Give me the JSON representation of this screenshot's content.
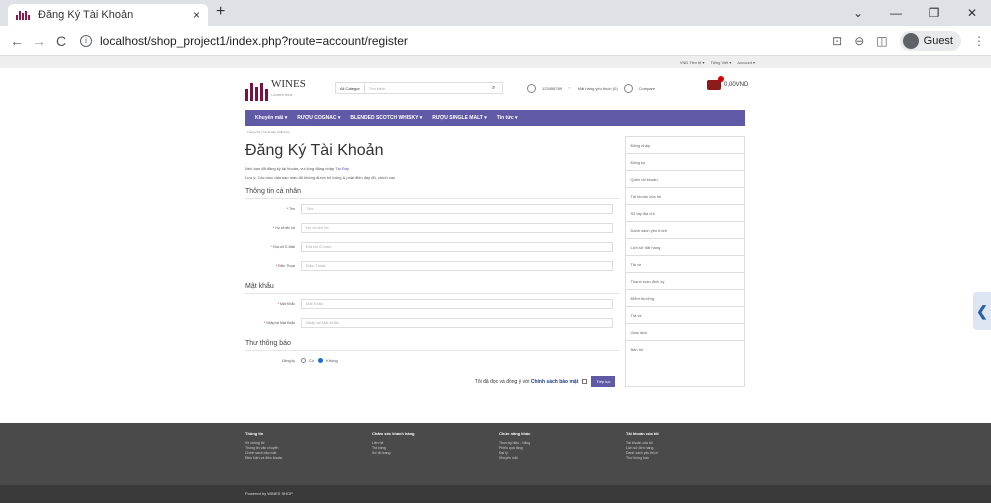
{
  "browser": {
    "tab_title": "Đăng Ký Tài Khoản",
    "tab_close": "×",
    "new_tab": "+",
    "url": "localhost/shop_project1/index.php?route=account/register",
    "profile": "Guest",
    "win_min": "—",
    "win_restore": "❐",
    "win_close": "✕",
    "win_menu": "⌄",
    "back": "←",
    "forward": "→",
    "reload": "C",
    "menu_dots": "⋮",
    "zoom": "⊖",
    "translate": "⊡",
    "split": "◫"
  },
  "topbar": {
    "currency": "VND Tiền tệ ▾",
    "language": "Tiếng Việt ▾",
    "account": "Account ▾"
  },
  "header": {
    "logo": "WINES",
    "logo_sub": "CASHIEN SHOP",
    "search_category": "All Categor",
    "search_placeholder": "Tìm kiếm",
    "phone": "123456789",
    "wishlist": "Mặt hàng yêu thích (0)",
    "compare": "Compare",
    "cart_total": "0,00VND"
  },
  "menu": {
    "items": [
      "Khuyến mãi ▾",
      "RƯỢU COGNAC ▾",
      "BLENDED SCOTCH WHISKY ▾",
      "RƯỢU SINGLE MALT ▾",
      "Tin tức ▾"
    ]
  },
  "breadcrumb": "Trang chủ  |  Tài khoản  |  Đăng Ký",
  "page": {
    "title": "Đăng Ký Tài Khoản",
    "note1_prefix": "Nếu bạn đã đăng ký tài khoản, vui lòng đăng nhập ",
    "note1_link": "Tại Đây.",
    "note2": "Lưu ý: Các mục dấu sao màu đỏ không được bỏ trống & phải điền đầy đủ, chính xác",
    "section_personal": "Thông tin cá nhân",
    "section_password": "Mật khẩu",
    "section_newsletter": "Thư thông báo",
    "fields": {
      "firstname_label": "Tên",
      "firstname_ph": "Tên:",
      "lastname_label": "Họ và tên lót",
      "lastname_ph": "Họ và tên lót:",
      "email_label": "Địa chỉ E-Mail",
      "email_ph": "Địa chỉ E-Mail",
      "phone_label": "Điện Thoại",
      "phone_ph": "Điện Thoại:",
      "password_label": "Mật Khẩu",
      "password_ph": "Mật Khẩu:",
      "confirm_label": "Nhập lại Mật Khẩu",
      "confirm_ph": "Nhập lại Mật Khẩu"
    },
    "subscribe_label": "Đăng ký",
    "subscribe_yes": "Có",
    "subscribe_no": "Không",
    "agree_text": "Tôi đã đọc và đồng ý với ",
    "agree_link": "Chính sách bảo mật",
    "submit": "Tiếp tục"
  },
  "sidebar": {
    "items": [
      "Đăng nhập",
      "Đăng ký",
      "Quên tài khoản",
      "Tài khoản của tôi",
      "Sổ tay địa chỉ",
      "Danh sách yêu thích",
      "Lịch sử đặt hàng",
      "Tải về",
      "Thanh toán định kỳ",
      "Điểm thưởng",
      "Trả về",
      "Giao dịch",
      "Bản tin"
    ]
  },
  "footer": {
    "cols": [
      {
        "title": "Thông tin",
        "links": [
          "Về chúng tôi",
          "Thông tin vận chuyển",
          "Chính sách bảo mật",
          "Điều kiện và điều khoản"
        ]
      },
      {
        "title": "Chăm sóc khách hàng",
        "links": [
          "Liên hệ",
          "Trả hàng",
          "Sơ đồ trang"
        ]
      },
      {
        "title": "Chức năng khác",
        "links": [
          "Thương hiệu - hãng",
          "Phiếu quà tặng",
          "Đại lý",
          "Khuyến mãi"
        ]
      },
      {
        "title": "Tài khoản của tôi",
        "links": [
          "Tài khoản của tôi",
          "Lịch sử đơn hàng",
          "Danh sách yêu thích",
          "Thư thông báo"
        ]
      }
    ],
    "powered": "Powered by WINES SHOP"
  }
}
